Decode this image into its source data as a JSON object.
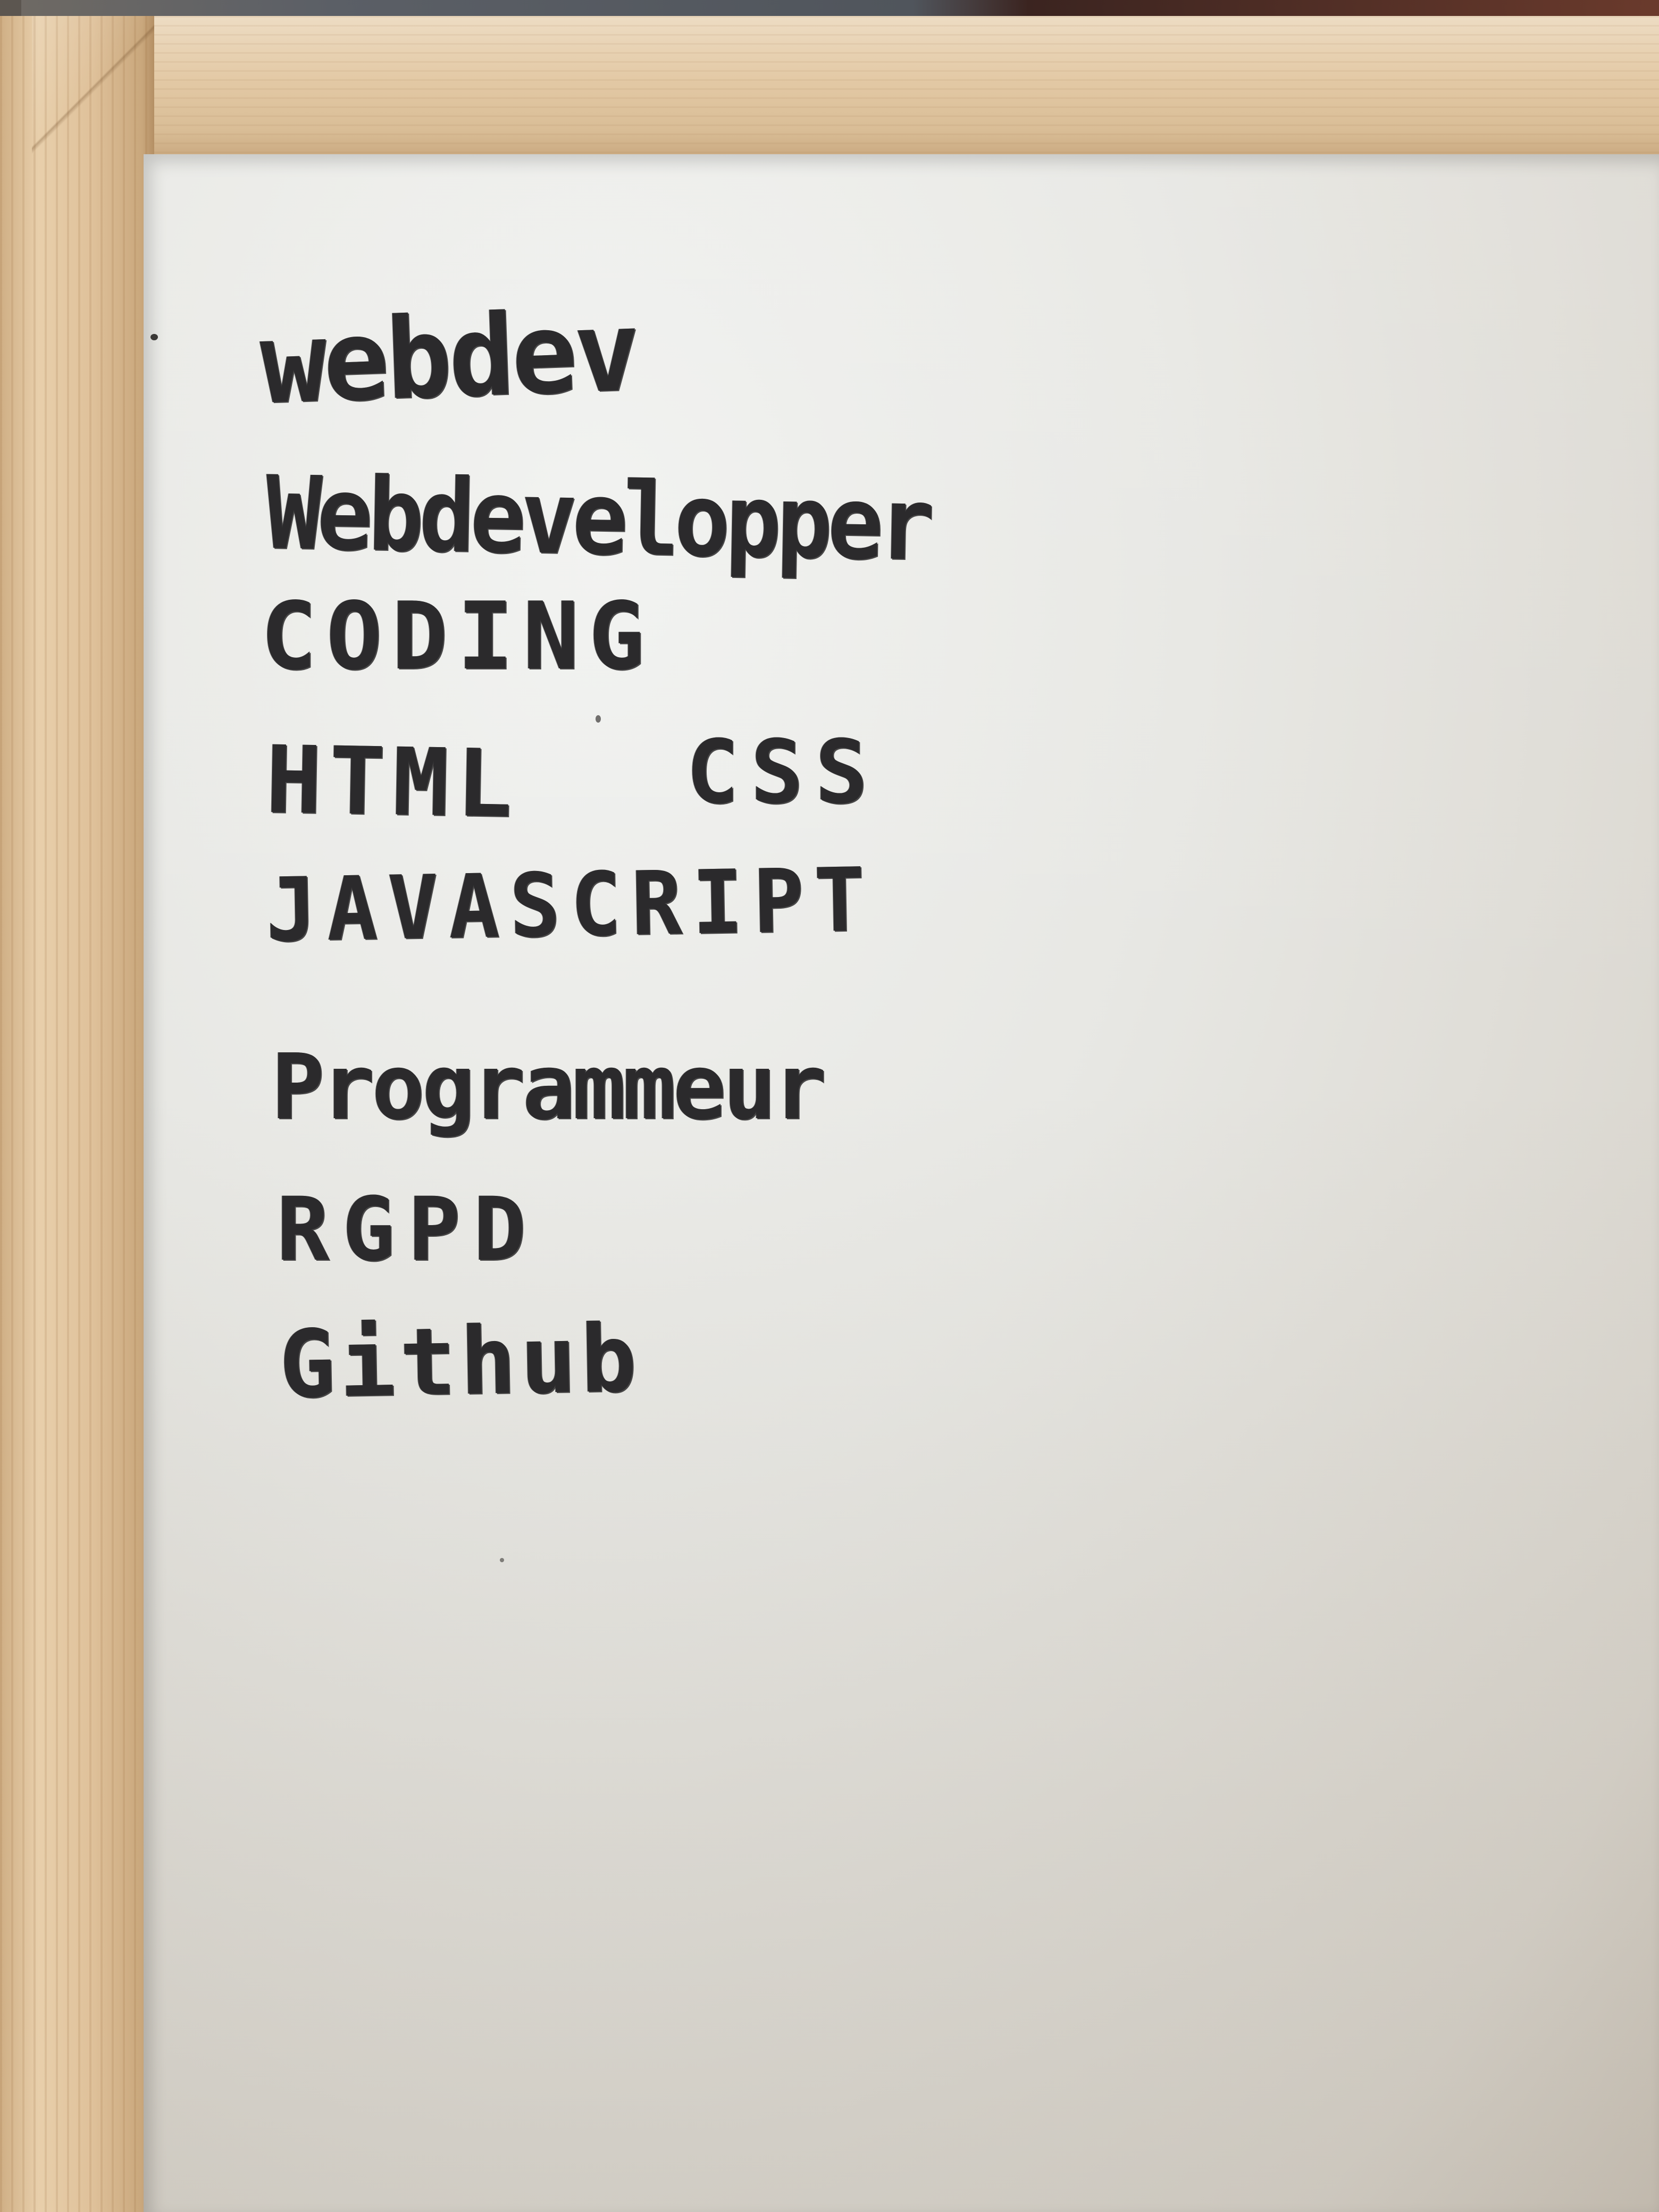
{
  "whiteboard": {
    "lines": [
      "webdev",
      "Webdevelopper",
      "CODING",
      "HTML",
      "CSS",
      "JAVASCRIPT",
      "Programmeur",
      "RGPD",
      "Github"
    ]
  },
  "colors": {
    "marker": "#2b2a2c",
    "board": "#e8e8e4",
    "frame": "#e2c9a6"
  }
}
